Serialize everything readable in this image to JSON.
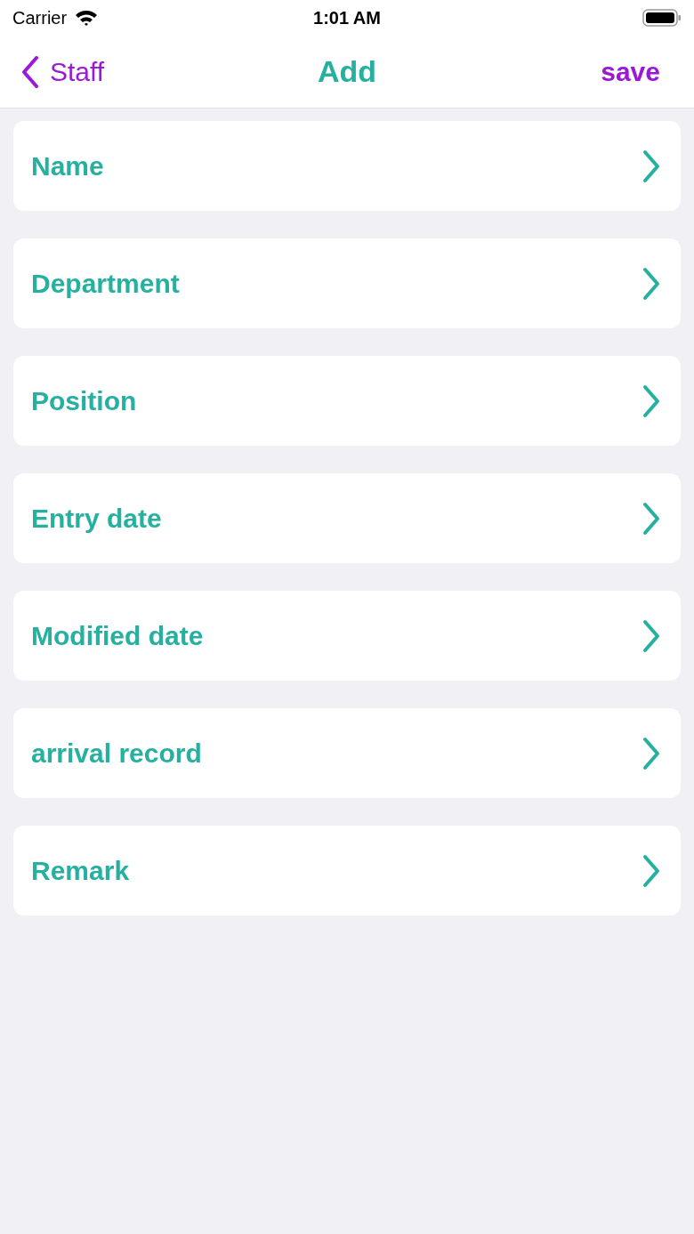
{
  "status_bar": {
    "carrier": "Carrier",
    "time": "1:01 AM"
  },
  "nav": {
    "back": "Staff",
    "title": "Add",
    "action": "save"
  },
  "rows": [
    {
      "label": "Name"
    },
    {
      "label": "Department"
    },
    {
      "label": "Position"
    },
    {
      "label": "Entry date"
    },
    {
      "label": "Modified date"
    },
    {
      "label": "arrival record"
    },
    {
      "label": "Remark"
    }
  ]
}
